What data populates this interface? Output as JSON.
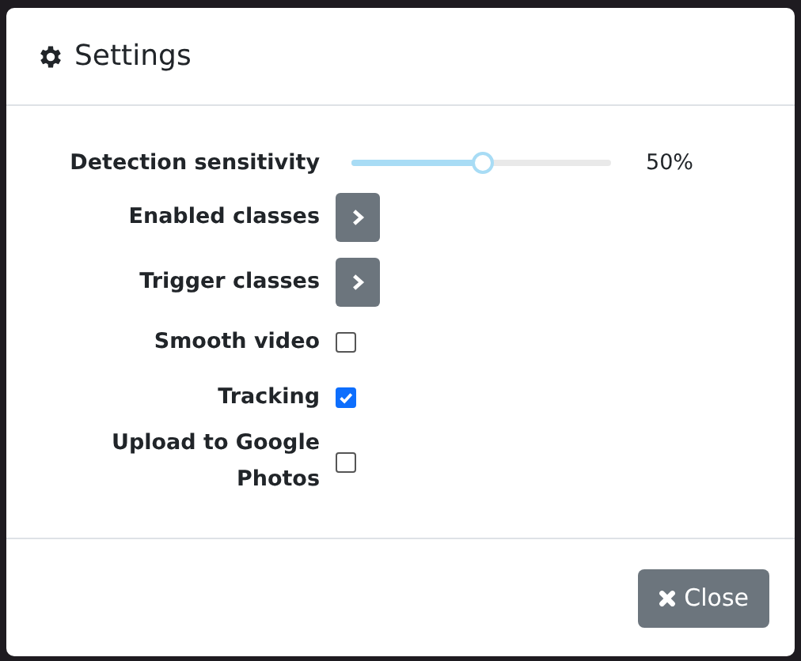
{
  "dialog": {
    "title": "Settings"
  },
  "settings": [
    {
      "kind": "slider",
      "label": "Detection sensitivity",
      "level": 0.5,
      "reading": "50%"
    },
    {
      "kind": "button",
      "label": "Enabled classes"
    },
    {
      "kind": "button",
      "label": "Trigger classes"
    },
    {
      "kind": "checkbox",
      "label": "Smooth video",
      "checked": false
    },
    {
      "kind": "checkbox",
      "label": "Tracking",
      "checked": true
    },
    {
      "kind": "checkbox",
      "label": "Upload to Google Photos",
      "checked": false
    }
  ],
  "footer": {
    "close_button": "Close"
  }
}
